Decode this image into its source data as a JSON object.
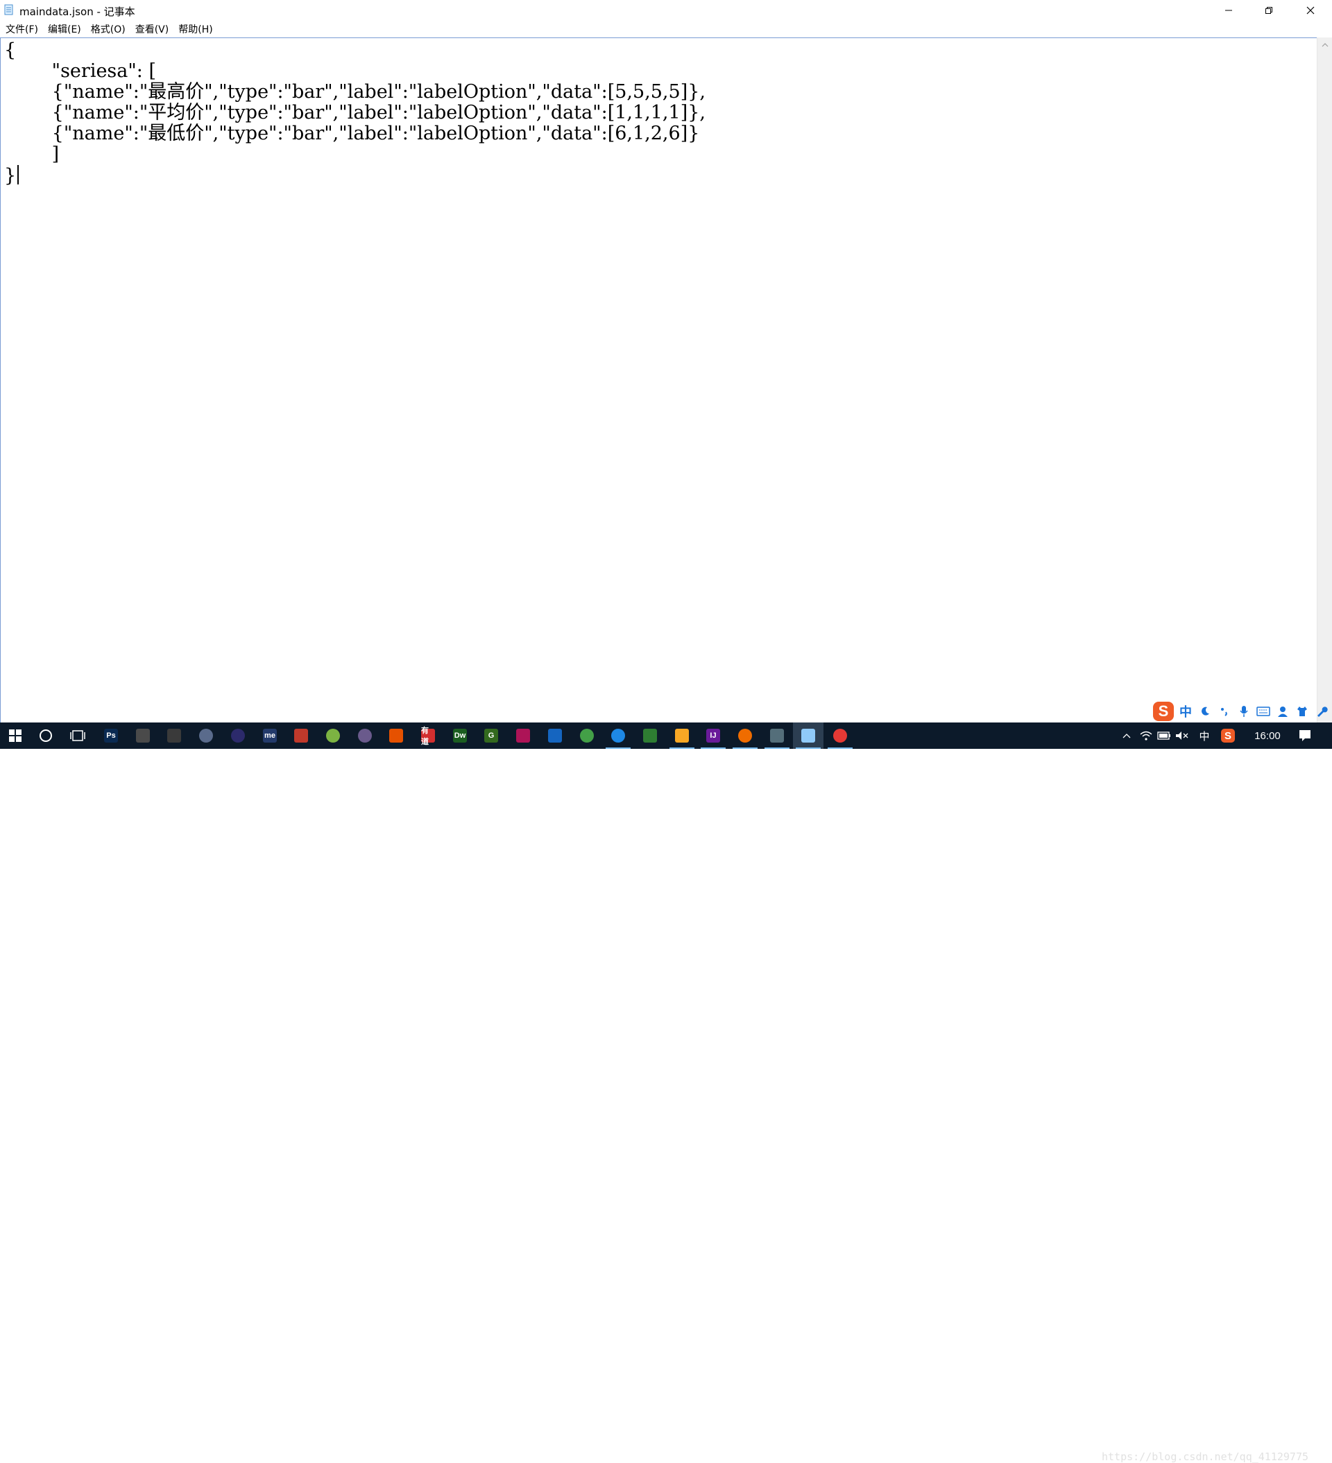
{
  "window": {
    "title": "maindata.json - 记事本"
  },
  "menu": {
    "items": [
      "文件(F)",
      "编辑(E)",
      "格式(O)",
      "查看(V)",
      "帮助(H)"
    ]
  },
  "editor": {
    "lines": [
      "{",
      "        \"seriesa\": [",
      "        {\"name\":\"最高价\",\"type\":\"bar\",\"label\":\"labelOption\",\"data\":[5,5,5,5]},",
      "        {\"name\":\"平均价\",\"type\":\"bar\",\"label\":\"labelOption\",\"data\":[1,1,1,1]},",
      "        {\"name\":\"最低价\",\"type\":\"bar\",\"label\":\"labelOption\",\"data\":[6,1,2,6]}",
      "        ]",
      "}"
    ]
  },
  "ime": {
    "logo": "S",
    "mode": "中"
  },
  "taskbar": {
    "apps": [
      {
        "name": "photoshop",
        "label": "Ps",
        "color": "#0a2a52"
      },
      {
        "name": "calculator",
        "label": "",
        "color": "#4a4a4a"
      },
      {
        "name": "camera",
        "label": "",
        "color": "#3a3a3a"
      },
      {
        "name": "app-4",
        "label": "",
        "color": "#5a6b8c"
      },
      {
        "name": "eclipse",
        "label": "",
        "color": "#2c2a6b"
      },
      {
        "name": "mindmanager",
        "label": "me",
        "color": "#233a6b"
      },
      {
        "name": "app-7",
        "label": "",
        "color": "#c0392b"
      },
      {
        "name": "app-8",
        "label": "",
        "color": "#7cb342"
      },
      {
        "name": "app-9",
        "label": "",
        "color": "#6a5a8c"
      },
      {
        "name": "app-10",
        "label": "",
        "color": "#e65100"
      },
      {
        "name": "youdao",
        "label": "有道",
        "color": "#d32f2f"
      },
      {
        "name": "dreamweaver",
        "label": "Dw",
        "color": "#1b5e20"
      },
      {
        "name": "app-13",
        "label": "G",
        "color": "#33691e"
      },
      {
        "name": "app-14",
        "label": "",
        "color": "#ad1457"
      },
      {
        "name": "app-15",
        "label": "",
        "color": "#1565c0"
      },
      {
        "name": "app-16",
        "label": "",
        "color": "#43a047"
      },
      {
        "name": "app-17",
        "label": "",
        "color": "#1e88e5"
      },
      {
        "name": "app-18",
        "label": "",
        "color": "#2e7d32"
      },
      {
        "name": "file-explorer",
        "label": "",
        "color": "#f9a825"
      },
      {
        "name": "intellij",
        "label": "IJ",
        "color": "#6a1b9a"
      },
      {
        "name": "app-21",
        "label": "",
        "color": "#ef6c00"
      },
      {
        "name": "app-22",
        "label": "",
        "color": "#546e7a"
      },
      {
        "name": "notepad",
        "label": "",
        "color": "#90caf9"
      },
      {
        "name": "chrome",
        "label": "",
        "color": "#e53935"
      }
    ],
    "tray": {
      "ime_indicator": "中",
      "clock": "16:00"
    },
    "watermark": "https://blog.csdn.net/qq_41129775"
  }
}
